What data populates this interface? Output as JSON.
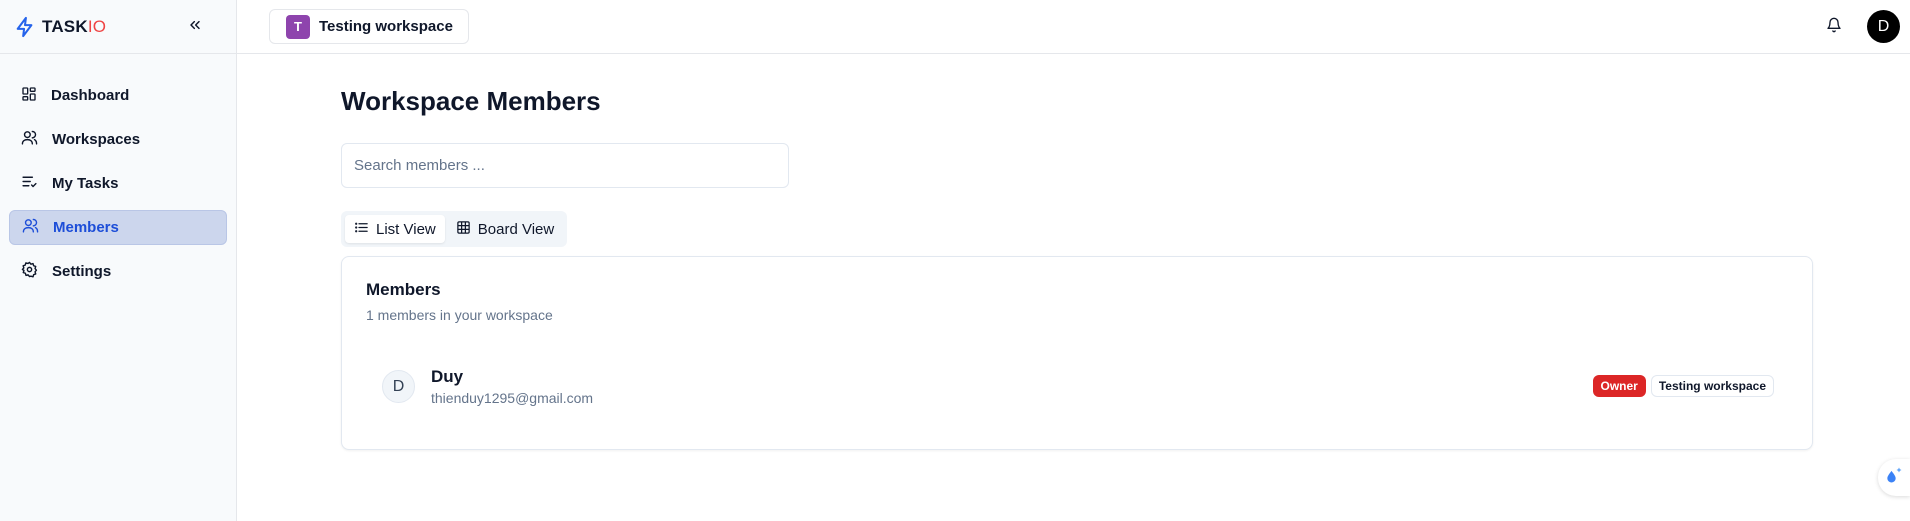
{
  "brand": {
    "name_main": "TASK",
    "name_accent": "IO",
    "accent_color": "#ef4444",
    "logo_color": "#2563eb"
  },
  "sidebar": {
    "items": [
      {
        "label": "Dashboard",
        "icon": "dashboard-icon",
        "active": false
      },
      {
        "label": "Workspaces",
        "icon": "users-icon",
        "active": false
      },
      {
        "label": "My Tasks",
        "icon": "list-check-icon",
        "active": false
      },
      {
        "label": "Members",
        "icon": "users-icon",
        "active": true
      },
      {
        "label": "Settings",
        "icon": "gear-icon",
        "active": false
      }
    ],
    "collapse_icon": "chevrons-left-icon"
  },
  "topbar": {
    "workspace": {
      "initial": "T",
      "name": "Testing workspace",
      "color": "#8e44ad"
    },
    "notification_icon": "bell-icon",
    "user_initial": "D"
  },
  "main": {
    "title": "Workspace Members",
    "search_placeholder": "Search members ...",
    "tabs": [
      {
        "label": "List View",
        "icon": "list-icon",
        "active": true
      },
      {
        "label": "Board View",
        "icon": "grid-icon",
        "active": false
      }
    ],
    "card": {
      "title": "Members",
      "subtitle": "1 members in your workspace",
      "members": [
        {
          "initial": "D",
          "name": "Duy",
          "email": "thienduy1295@gmail.com",
          "role": "Owner",
          "workspace": "Testing workspace"
        }
      ]
    }
  },
  "colors": {
    "active_nav_bg": "#ccd6ed",
    "active_nav_text": "#1d4ed8",
    "owner_badge": "#dc2626"
  }
}
